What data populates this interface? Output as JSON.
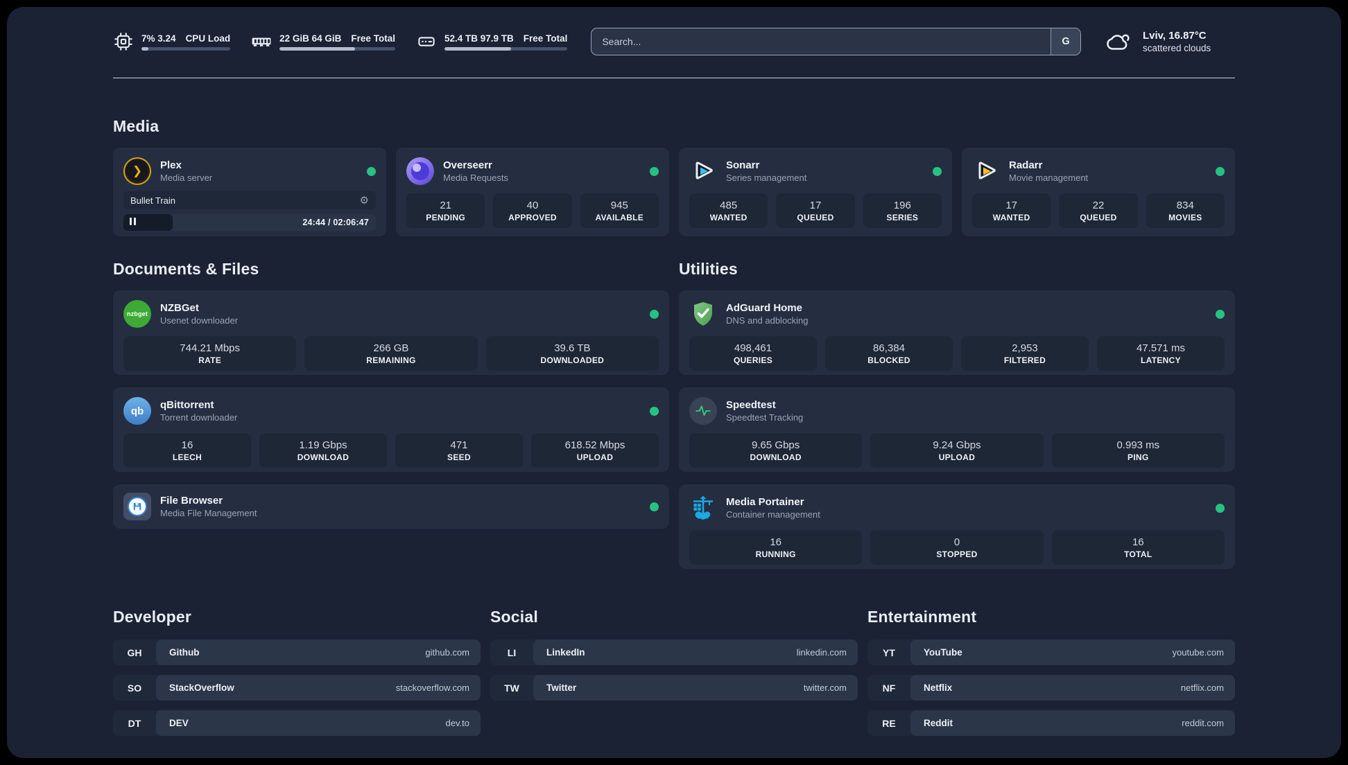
{
  "header": {
    "stats": [
      {
        "icon": "cpu-icon",
        "line1": "7%",
        "line2": "3.24",
        "label1": "CPU",
        "label2": "Load",
        "progress_pct": 8
      },
      {
        "icon": "memory-icon",
        "line1": "22 GiB",
        "line2": "64 GiB",
        "label1": "Free",
        "label2": "Total",
        "progress_pct": 65
      },
      {
        "icon": "disk-icon",
        "line1": "52.4 TB",
        "line2": "97.9 TB",
        "label1": "Free",
        "label2": "Total",
        "progress_pct": 54
      }
    ],
    "search": {
      "placeholder": "Search...",
      "engine_button": "G"
    },
    "weather": {
      "location": "Lviv, 16.87°C",
      "condition": "scattered clouds"
    }
  },
  "sections": {
    "media": {
      "title": "Media",
      "cards": [
        {
          "name": "Plex",
          "description": "Media server",
          "status": "online",
          "player": {
            "title": "Bullet Train",
            "time": "24:44 / 02:06:47",
            "progress_pct": 19.5
          }
        },
        {
          "name": "Overseerr",
          "description": "Media Requests",
          "status": "online",
          "stats": [
            {
              "value": "21",
              "label": "PENDING"
            },
            {
              "value": "40",
              "label": "APPROVED"
            },
            {
              "value": "945",
              "label": "AVAILABLE"
            }
          ]
        },
        {
          "name": "Sonarr",
          "description": "Series management",
          "status": "online",
          "stats": [
            {
              "value": "485",
              "label": "WANTED"
            },
            {
              "value": "17",
              "label": "QUEUED"
            },
            {
              "value": "196",
              "label": "SERIES"
            }
          ]
        },
        {
          "name": "Radarr",
          "description": "Movie management",
          "status": "online",
          "stats": [
            {
              "value": "17",
              "label": "WANTED"
            },
            {
              "value": "22",
              "label": "QUEUED"
            },
            {
              "value": "834",
              "label": "MOVIES"
            }
          ]
        }
      ]
    },
    "documents": {
      "title": "Documents & Files",
      "cards": [
        {
          "name": "NZBGet",
          "description": "Usenet downloader",
          "status": "online",
          "stats": [
            {
              "value": "744.21 Mbps",
              "label": "RATE"
            },
            {
              "value": "266 GB",
              "label": "REMAINING"
            },
            {
              "value": "39.6 TB",
              "label": "DOWNLOADED"
            }
          ]
        },
        {
          "name": "qBittorrent",
          "description": "Torrent downloader",
          "status": "online",
          "stats": [
            {
              "value": "16",
              "label": "LEECH"
            },
            {
              "value": "1.19 Gbps",
              "label": "DOWNLOAD"
            },
            {
              "value": "471",
              "label": "SEED"
            },
            {
              "value": "618.52 Mbps",
              "label": "UPLOAD"
            }
          ]
        },
        {
          "name": "File Browser",
          "description": "Media File Management",
          "status": "online"
        }
      ]
    },
    "utilities": {
      "title": "Utilities",
      "cards": [
        {
          "name": "AdGuard Home",
          "description": "DNS and adblocking",
          "status": "online",
          "stats": [
            {
              "value": "498,461",
              "label": "QUERIES"
            },
            {
              "value": "86,384",
              "label": "BLOCKED"
            },
            {
              "value": "2,953",
              "label": "FILTERED"
            },
            {
              "value": "47.571 ms",
              "label": "LATENCY"
            }
          ]
        },
        {
          "name": "Speedtest",
          "description": "Speedtest Tracking",
          "status": "online",
          "stats": [
            {
              "value": "9.65 Gbps",
              "label": "DOWNLOAD"
            },
            {
              "value": "9.24 Gbps",
              "label": "UPLOAD"
            },
            {
              "value": "0.993 ms",
              "label": "PING"
            }
          ]
        },
        {
          "name": "Media Portainer",
          "description": "Container management",
          "status": "online",
          "stats": [
            {
              "value": "16",
              "label": "RUNNING"
            },
            {
              "value": "0",
              "label": "STOPPED"
            },
            {
              "value": "16",
              "label": "TOTAL"
            }
          ]
        }
      ]
    },
    "links": [
      {
        "title": "Developer",
        "items": [
          {
            "abbr": "GH",
            "name": "Github",
            "url": "github.com"
          },
          {
            "abbr": "SO",
            "name": "StackOverflow",
            "url": "stackoverflow.com"
          },
          {
            "abbr": "DT",
            "name": "DEV",
            "url": "dev.to"
          }
        ]
      },
      {
        "title": "Social",
        "items": [
          {
            "abbr": "LI",
            "name": "LinkedIn",
            "url": "linkedin.com"
          },
          {
            "abbr": "TW",
            "name": "Twitter",
            "url": "twitter.com"
          }
        ]
      },
      {
        "title": "Entertainment",
        "items": [
          {
            "abbr": "YT",
            "name": "YouTube",
            "url": "youtube.com"
          },
          {
            "abbr": "NF",
            "name": "Netflix",
            "url": "netflix.com"
          },
          {
            "abbr": "RE",
            "name": "Reddit",
            "url": "reddit.com"
          }
        ]
      }
    ]
  },
  "icons": {
    "plex_glyph": "❯",
    "nzbget_glyph": "nzbget",
    "qbittorrent_glyph": "qb",
    "gear_glyph": "⚙"
  },
  "colors": {
    "status_online": "#26c281",
    "plex_amber": "#eead0e",
    "sonarr_blue": "#35c5f4",
    "radarr_amber": "#fbbf24",
    "adguard_green": "#68bc71",
    "qbittorrent_blue": "#4f9fe0",
    "nzbget_green": "#3daa35",
    "portainer_blue": "#1ba8e3",
    "overseerr_purple": "#6f5bd6",
    "speedtest_pulse": "#2bd47d"
  }
}
